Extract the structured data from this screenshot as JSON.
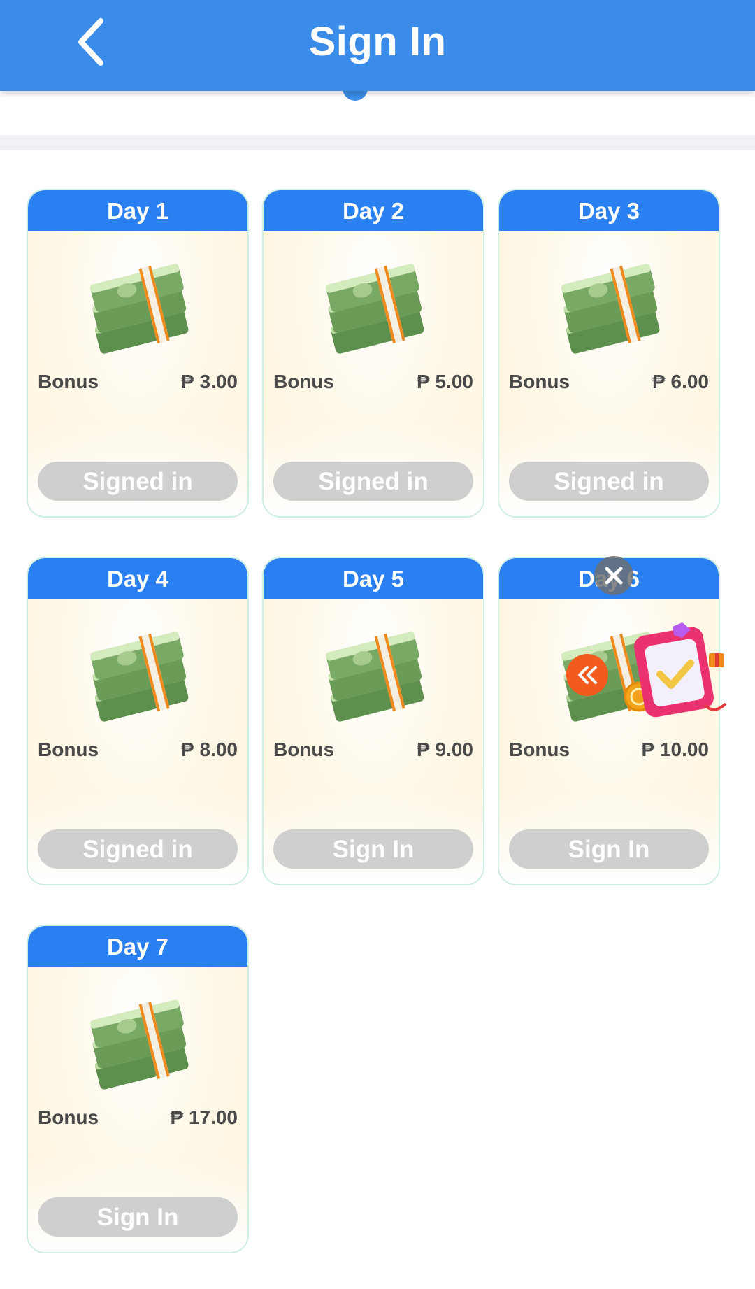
{
  "header": {
    "title": "Sign In"
  },
  "currency": "₱",
  "days": [
    {
      "label": "Day 1",
      "bonus_label": "Bonus",
      "amount": "₱ 3.00",
      "button": "Signed in"
    },
    {
      "label": "Day 2",
      "bonus_label": "Bonus",
      "amount": "₱ 5.00",
      "button": "Signed in"
    },
    {
      "label": "Day 3",
      "bonus_label": "Bonus",
      "amount": "₱ 6.00",
      "button": "Signed in"
    },
    {
      "label": "Day 4",
      "bonus_label": "Bonus",
      "amount": "₱ 8.00",
      "button": "Signed in"
    },
    {
      "label": "Day 5",
      "bonus_label": "Bonus",
      "amount": "₱ 9.00",
      "button": "Sign In"
    },
    {
      "label": "Day 6",
      "bonus_label": "Bonus",
      "amount": "₱ 10.00",
      "button": "Sign In"
    },
    {
      "label": "Day 7",
      "bonus_label": "Bonus",
      "amount": "₱ 17.00",
      "button": "Sign In"
    }
  ],
  "icons": {
    "back": "back-arrow-icon",
    "money": "money-stack-icon",
    "close": "close-icon",
    "expand": "double-chevron-left-icon",
    "gift": "checkin-gift-icon"
  },
  "colors": {
    "header": "#3a8ce8",
    "day_header": "#2a80f0",
    "button_disabled": "#cfcfcf",
    "float_orange": "#f25a1e"
  }
}
